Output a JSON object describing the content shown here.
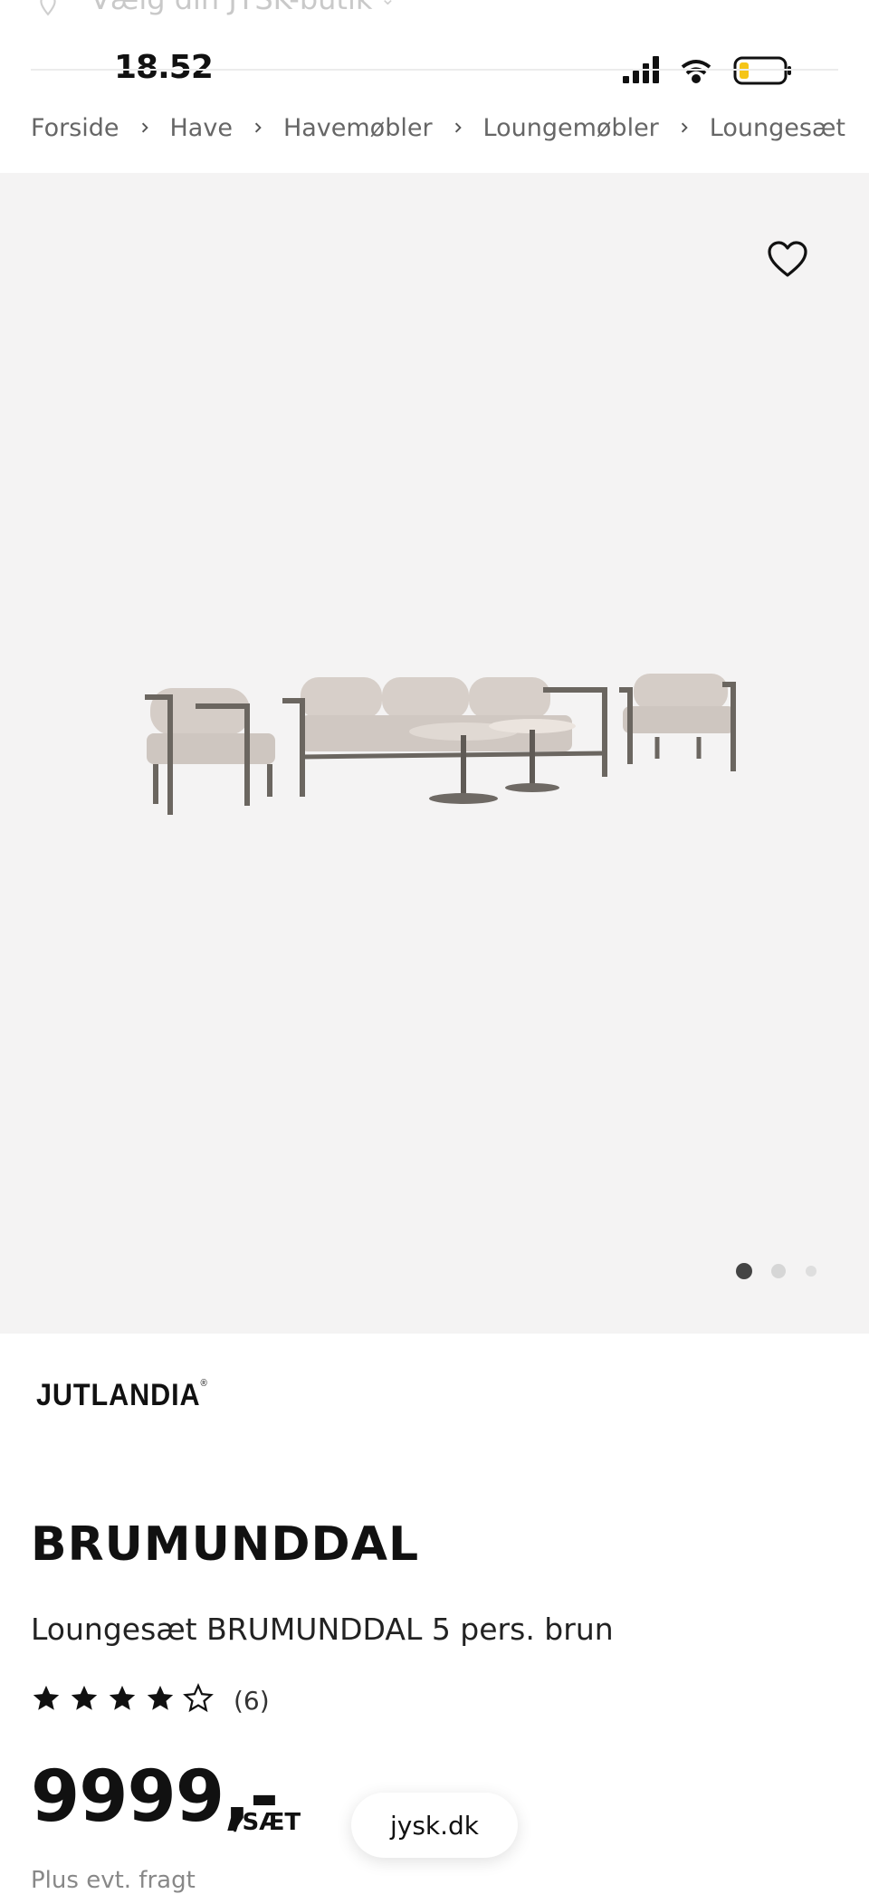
{
  "store_bar": {
    "text": "Vælg din JYSK-butik"
  },
  "status": {
    "time": "18.52"
  },
  "breadcrumb": [
    "Forside",
    "Have",
    "Havemøbler",
    "Loungemøbler",
    "Loungesæt"
  ],
  "gallery": {
    "image_count": 3,
    "active_index": 0
  },
  "brand": {
    "logo_text": "JUTLANDIA",
    "registered": "®"
  },
  "product": {
    "name": "BRUMUNDDAL",
    "subtitle": "Loungesæt BRUMUNDDAL 5 pers. brun",
    "rating": 4,
    "rating_max": 5,
    "review_count": "(6)",
    "price": "9999,-",
    "price_unit": "/SÆT",
    "freight_note": "Plus evt. fragt"
  },
  "browser": {
    "url": "jysk.dk"
  },
  "colors": {
    "gallery_bg": "#f4f3f3",
    "text": "#111111",
    "muted": "#666666"
  }
}
